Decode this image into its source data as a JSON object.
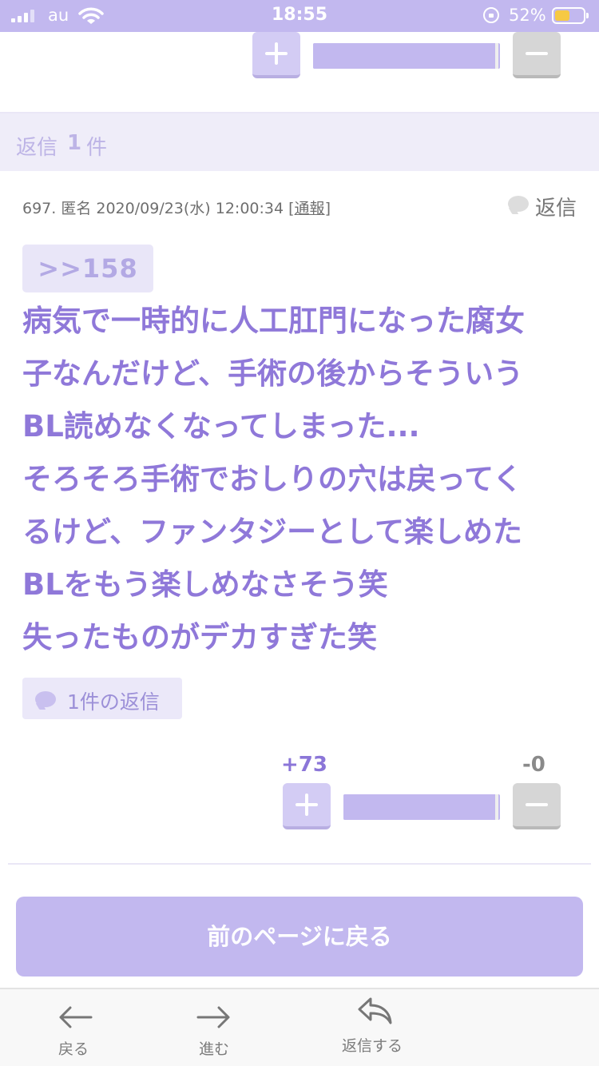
{
  "status_bar": {
    "carrier": "au",
    "time": "18:55",
    "battery_percent": "52%",
    "battery_level": 0.52
  },
  "top_vote": {
    "plus_symbol": "+",
    "minus_symbol": "−"
  },
  "reply_header": {
    "prefix": "返信",
    "count": "1",
    "suffix": "件"
  },
  "post": {
    "meta": "697. 匿名 2020/09/23(水) 12:00:34 [",
    "report_link": "通報",
    "meta_close": "]",
    "reply_label": "返信",
    "anchor": ">>158",
    "body_lines": [
      "病気で一時的に人工肛門になった腐女",
      "子なんだけど、手術の後からそういう",
      "BL読めなくなってしまった...",
      "そろそろ手術でおしりの穴は戻ってく",
      "るけど、ファンタジーとして楽しめた",
      "BLをもう楽しめなさそう笑",
      "失ったものがデカすぎた笑"
    ],
    "reply_count_label": "1件の返信",
    "plus_score": "+73",
    "minus_score": "-0",
    "vote_ratio": 0.99
  },
  "back_button_label": "前のページに戻る",
  "toolbar": {
    "back_label": "戻る",
    "forward_label": "進む",
    "reply_label": "返信する"
  },
  "colors": {
    "accent": "#c2b8ef",
    "text_purple": "#8f78d9",
    "status_bar": "#c2b8ef"
  }
}
